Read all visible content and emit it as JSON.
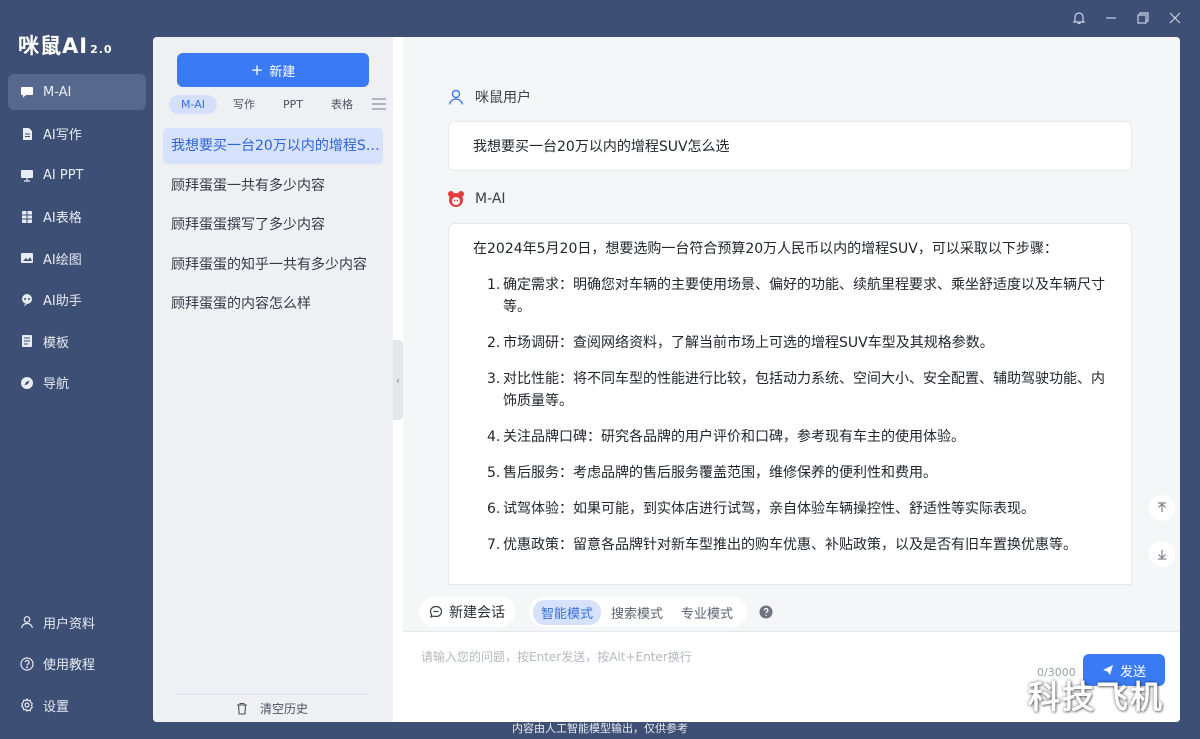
{
  "app": {
    "logo_text": "咪鼠AI",
    "version": "2.0"
  },
  "nav": {
    "items": [
      {
        "label": "M-AI",
        "icon": "chat-bubble-icon",
        "active": true
      },
      {
        "label": "AI写作",
        "icon": "document-icon"
      },
      {
        "label": "AI PPT",
        "icon": "presentation-icon"
      },
      {
        "label": "AI表格",
        "icon": "table-icon"
      },
      {
        "label": "AI绘图",
        "icon": "paint-icon"
      },
      {
        "label": "AI助手",
        "icon": "assistant-icon"
      },
      {
        "label": "模板",
        "icon": "template-icon"
      },
      {
        "label": "导航",
        "icon": "compass-icon"
      }
    ],
    "bottom": [
      {
        "label": "用户资料",
        "icon": "user-icon"
      },
      {
        "label": "使用教程",
        "icon": "help-icon"
      },
      {
        "label": "设置",
        "icon": "settings-icon"
      }
    ]
  },
  "history": {
    "new_button": "新建",
    "tabs": [
      "M-AI",
      "写作",
      "PPT",
      "表格"
    ],
    "items": [
      "我想要买一台20万以内的增程SUV怎么选",
      "顾拜蛋蛋一共有多少内容",
      "顾拜蛋蛋撰写了多少内容",
      "顾拜蛋蛋的知乎一共有多少内容",
      "顾拜蛋蛋的内容怎么样"
    ],
    "clear_label": "清空历史"
  },
  "chat": {
    "user_name": "咪鼠用户",
    "user_message": "我想要买一台20万以内的增程SUV怎么选",
    "ai_name": "M-AI",
    "ai_intro": "在2024年5月20日，想要选购一台符合预算20万人民币以内的增程SUV，可以采取以下步骤：",
    "steps": [
      {
        "n": "1.",
        "text": "确定需求：明确您对车辆的主要使用场景、偏好的功能、续航里程要求、乘坐舒适度以及车辆尺寸等。"
      },
      {
        "n": "2.",
        "text": "市场调研：查阅网络资料，了解当前市场上可选的增程SUV车型及其规格参数。"
      },
      {
        "n": "3.",
        "text": "对比性能：将不同车型的性能进行比较，包括动力系统、空间大小、安全配置、辅助驾驶功能、内饰质量等。"
      },
      {
        "n": "4.",
        "text": "关注品牌口碑：研究各品牌的用户评价和口碑，参考现有车主的使用体验。"
      },
      {
        "n": "5.",
        "text": "售后服务：考虑品牌的售后服务覆盖范围，维修保养的便利性和费用。"
      },
      {
        "n": "6.",
        "text": "试驾体验：如果可能，到实体店进行试驾，亲自体验车辆操控性、舒适性等实际表现。"
      },
      {
        "n": "7.",
        "text": "优惠政策：留意各品牌针对新车型推出的购车优惠、补贴政策，以及是否有旧车置换优惠等。"
      }
    ]
  },
  "toolbar": {
    "new_chat": "新建会话",
    "modes": [
      "智能模式",
      "搜索模式",
      "专业模式"
    ]
  },
  "input": {
    "placeholder": "请输入您的问题，按Enter发送，按Alt+Enter换行",
    "char_count": "0/3000",
    "send_label": "发送"
  },
  "footer": {
    "disclaimer": "内容由人工智能模型输出，仅供参考"
  },
  "watermark": "科技飞机",
  "colors": {
    "accent": "#3a7bf5",
    "sidebar_bg": "#3d4f74",
    "active_item": "#d6e2fb"
  }
}
